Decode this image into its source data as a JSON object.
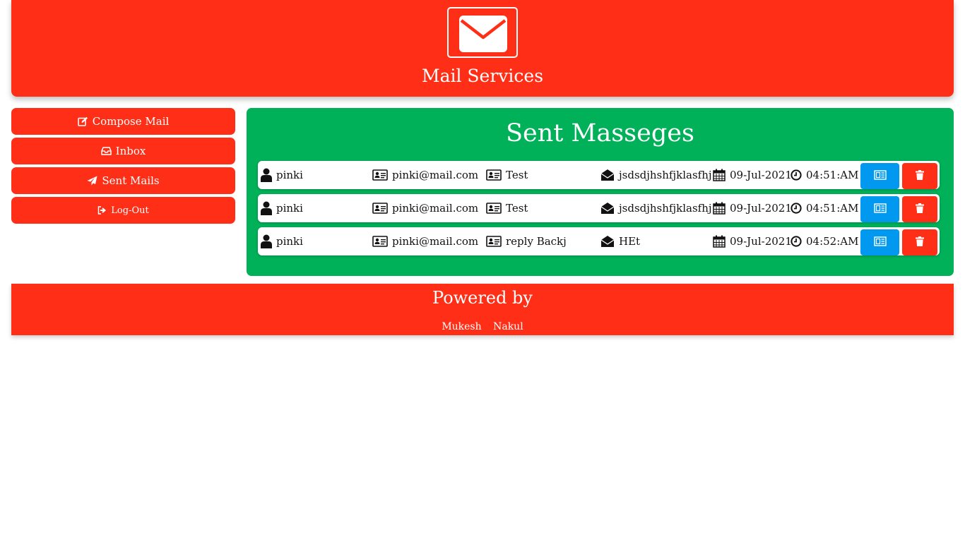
{
  "header": {
    "title": "Mail Services",
    "logo_icon": "envelope-icon"
  },
  "colors": {
    "primary": "#ff2e17",
    "panel": "#00b159",
    "view_button": "#0099ef"
  },
  "sidebar": {
    "items": [
      {
        "label": "Compose Mail",
        "icon": "edit-icon"
      },
      {
        "label": "Inbox",
        "icon": "inbox-icon"
      },
      {
        "label": "Sent Mails",
        "icon": "paper-plane-icon"
      },
      {
        "label": "Log-Out",
        "icon": "sign-out-icon"
      }
    ]
  },
  "main": {
    "title": "Sent Masseges",
    "rows": [
      {
        "user": "pinki",
        "email": "pinki@mail.com",
        "subject": "Test",
        "message": "jsdsdjhshfjklasfhj",
        "date": "09-Jul-2021",
        "time": "04:51:AM"
      },
      {
        "user": "pinki",
        "email": "pinki@mail.com",
        "subject": "Test",
        "message": "jsdsdjhshfjklasfhj",
        "date": "09-Jul-2021",
        "time": "04:51:AM"
      },
      {
        "user": "pinki",
        "email": "pinki@mail.com",
        "subject": "reply Backj",
        "message": "HEt",
        "date": "09-Jul-2021",
        "time": "04:52:AM"
      }
    ]
  },
  "footer": {
    "title": "Powered by",
    "names": [
      "Mukesh",
      "Nakul"
    ]
  }
}
